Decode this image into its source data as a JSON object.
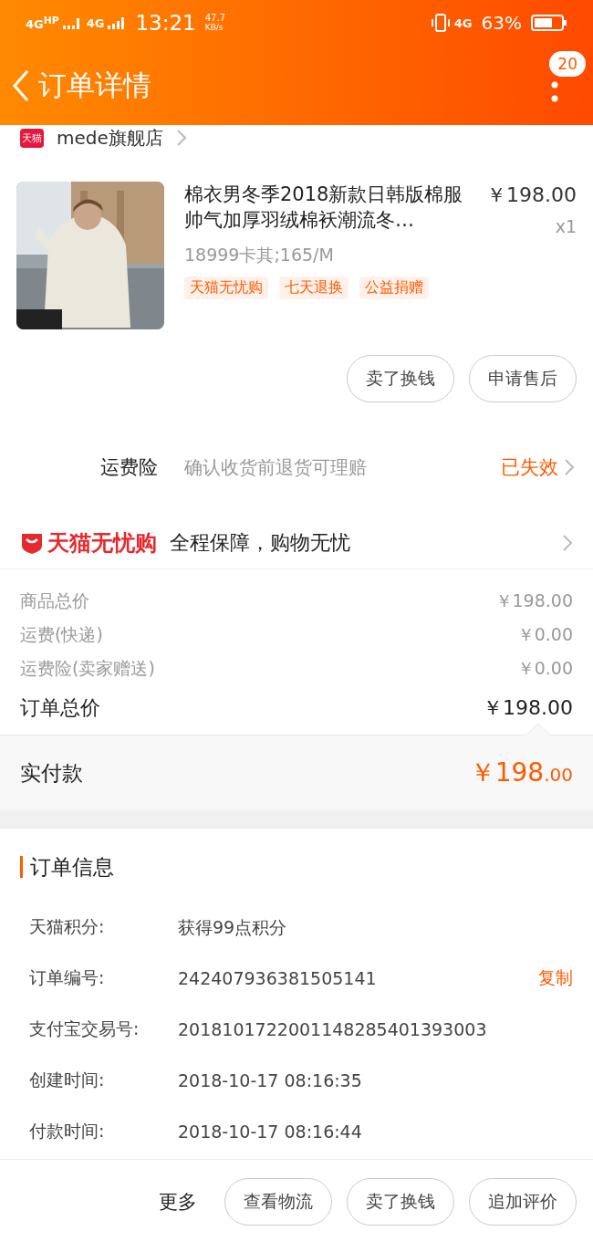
{
  "status_bar": {
    "network_1": "4G$^{HP}$",
    "network_2": "4G",
    "time": "13:21",
    "speed": "47.7",
    "speed_unit": "KB/s",
    "network_3": "4G",
    "battery": "63%"
  },
  "header": {
    "title": "订单详情",
    "badge": "20"
  },
  "store": {
    "logo_text": "天猫",
    "name": "mede旗舰店"
  },
  "product": {
    "title": "棉衣男冬季2018新款日韩版棉服帅气加厚羽绒棉袄潮流冬…",
    "spec": "18999卡其;165/M",
    "price": "￥198.00",
    "quantity": "x1",
    "tags": [
      "天猫无忧购",
      "七天退换",
      "公益捐赠"
    ]
  },
  "item_actions": [
    "卖了换钱",
    "申请售后"
  ],
  "insurance": {
    "label": "运费险",
    "description": "确认收货前退货可理赔",
    "status": "已失效"
  },
  "guarantee": {
    "brand": "天猫无忧购",
    "text": "全程保障，购物无忧"
  },
  "summary": [
    {
      "kind": "minor",
      "label": "商品总价",
      "value": "￥198.00"
    },
    {
      "kind": "minor",
      "label": "运费(快递)",
      "value": "￥0.00"
    },
    {
      "kind": "minor",
      "label": "运费险(卖家赠送)",
      "value": "￥0.00"
    },
    {
      "kind": "total",
      "label": "订单总价",
      "value": "￥198.00"
    }
  ],
  "payment": {
    "label": "实付款",
    "value_main": "￥198",
    "value_fraction": ".00"
  },
  "order_info": {
    "title": "订单信息",
    "rows": [
      {
        "label": "天猫积分:",
        "value": "获得99点积分"
      },
      {
        "label": "订单编号:",
        "value": "242407936381505141",
        "action": "复制"
      },
      {
        "label": "支付宝交易号:",
        "value": "2018101722001148285401393003"
      },
      {
        "label": "创建时间:",
        "value": "2018-10-17 08:16:35"
      },
      {
        "label": "付款时间:",
        "value": "2018-10-17 08:16:44"
      }
    ]
  },
  "bottom_bar": {
    "more": "更多",
    "buttons": [
      "查看物流",
      "卖了换钱",
      "追加评价"
    ]
  }
}
